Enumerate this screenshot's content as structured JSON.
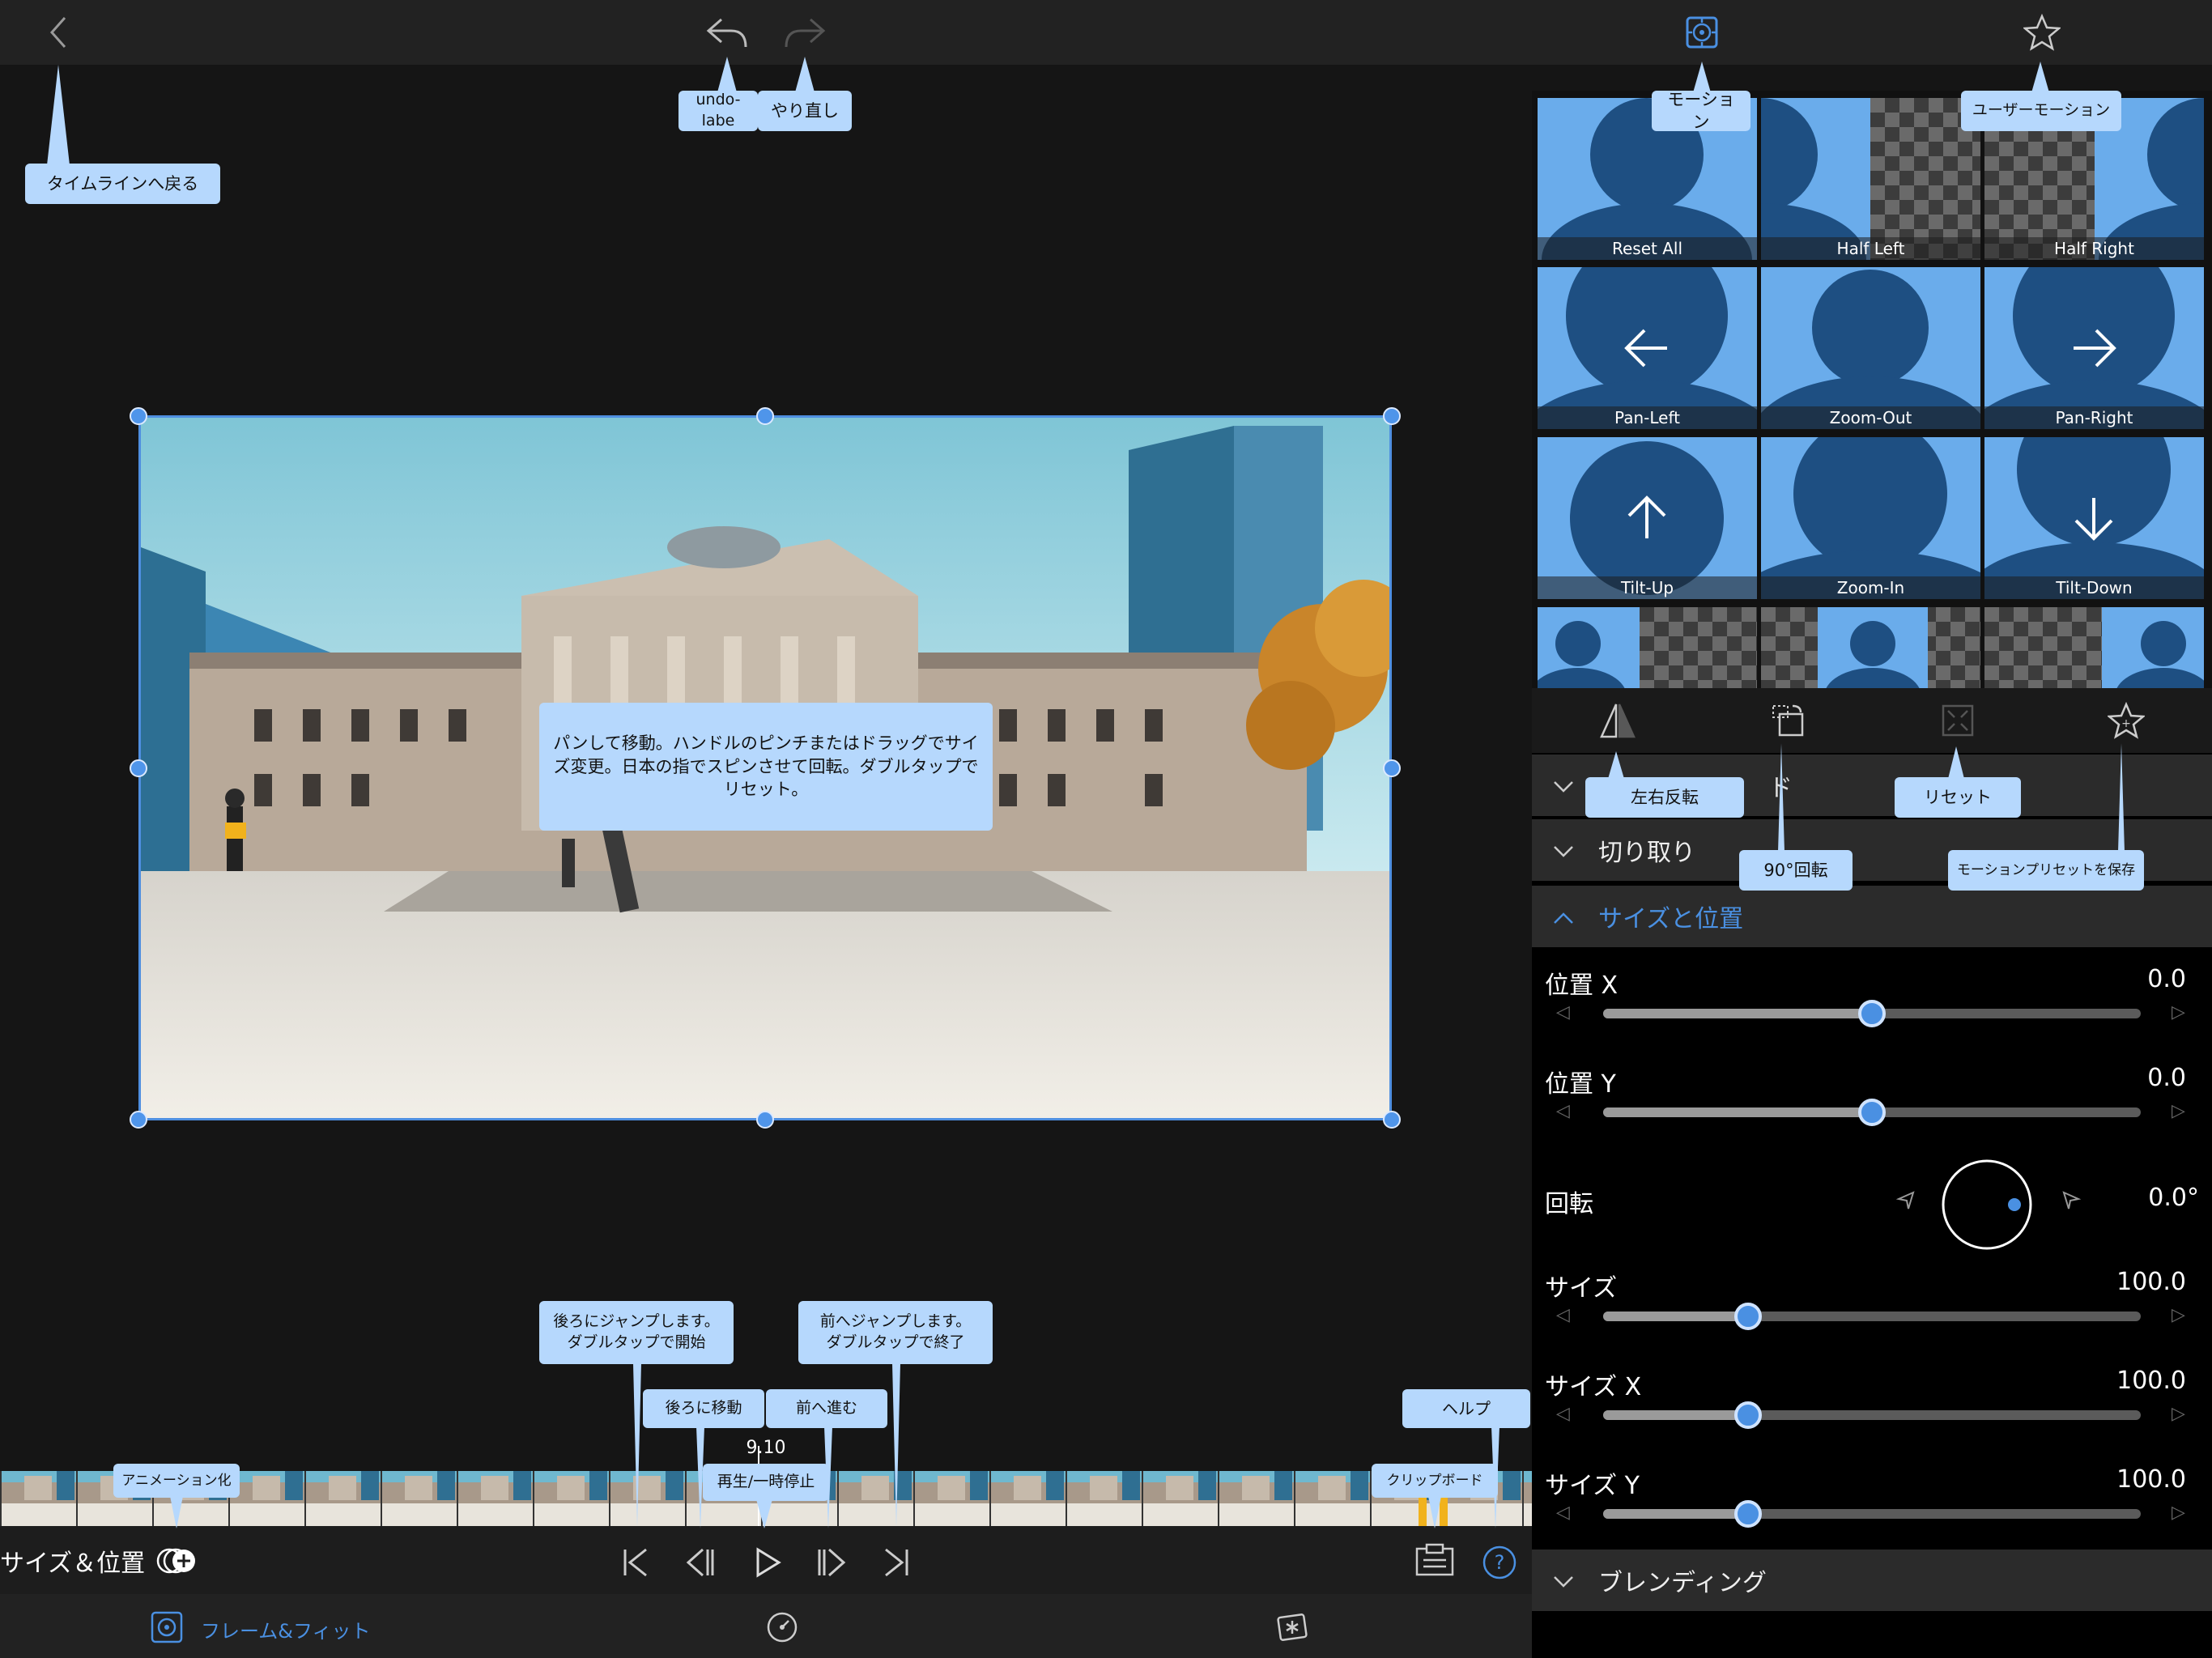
{
  "colors": {
    "accent": "#4a90e2",
    "tooltip_bg": "#b6d8fd",
    "panel_bg": "#000000",
    "section_bg": "#2b2b2b"
  },
  "tooltips": {
    "back": "タイムラインへ戻る",
    "undo": "undo-labe",
    "redo": "やり直し",
    "motion": "モーション",
    "user_motion": "ユーザーモーション",
    "viewer_help": "パンして移動。ハンドルのピンチまたはドラッグでサイズ変更。日本の指でスピンさせて回転。ダブルタップでリセット。",
    "flip": "左右反転",
    "rotate90": "90°回転",
    "reset": "リセット",
    "save_preset": "モーションプリセットを保存",
    "jump_back": "後ろにジャンプします。\nダブルタップで開始",
    "jump_forward": "前へジャンプします。\nダブルタップで終了",
    "step_back": "後ろに移動",
    "step_forward": "前へ進む",
    "play_pause": "再生/一時停止",
    "animate": "アニメーション化",
    "clipboard": "クリップボード",
    "help": "ヘルプ"
  },
  "presets": [
    {
      "label": "Reset All"
    },
    {
      "label": "Half Left"
    },
    {
      "label": "Half Right"
    },
    {
      "label": "Pan-Left"
    },
    {
      "label": "Zoom-Out"
    },
    {
      "label": "Pan-Right"
    },
    {
      "label": "Tilt-Up"
    },
    {
      "label": "Zoom-In"
    },
    {
      "label": "Tilt-Down"
    }
  ],
  "sections": {
    "blend_mode_partial": "ド",
    "crop": "切り取り",
    "size_position": "サイズと位置",
    "blending": "ブレンディング"
  },
  "controls": {
    "pos_x": {
      "label": "位置 X",
      "value": "0.0",
      "level": 0.5
    },
    "pos_y": {
      "label": "位置 Y",
      "value": "0.0",
      "level": 0.5
    },
    "rotation": {
      "label": "回転",
      "value": "0.0°"
    },
    "size": {
      "label": "サイズ",
      "value": "100.0",
      "level": 0.27
    },
    "size_x": {
      "label": "サイズ X",
      "value": "100.0",
      "level": 0.27
    },
    "size_y": {
      "label": "サイズ Y",
      "value": "100.0",
      "level": 0.27
    }
  },
  "timecode": "9.10",
  "ctrlbar": {
    "label": "サイズ＆位置"
  },
  "tabs": {
    "frame_fit": "フレーム&フィット"
  }
}
